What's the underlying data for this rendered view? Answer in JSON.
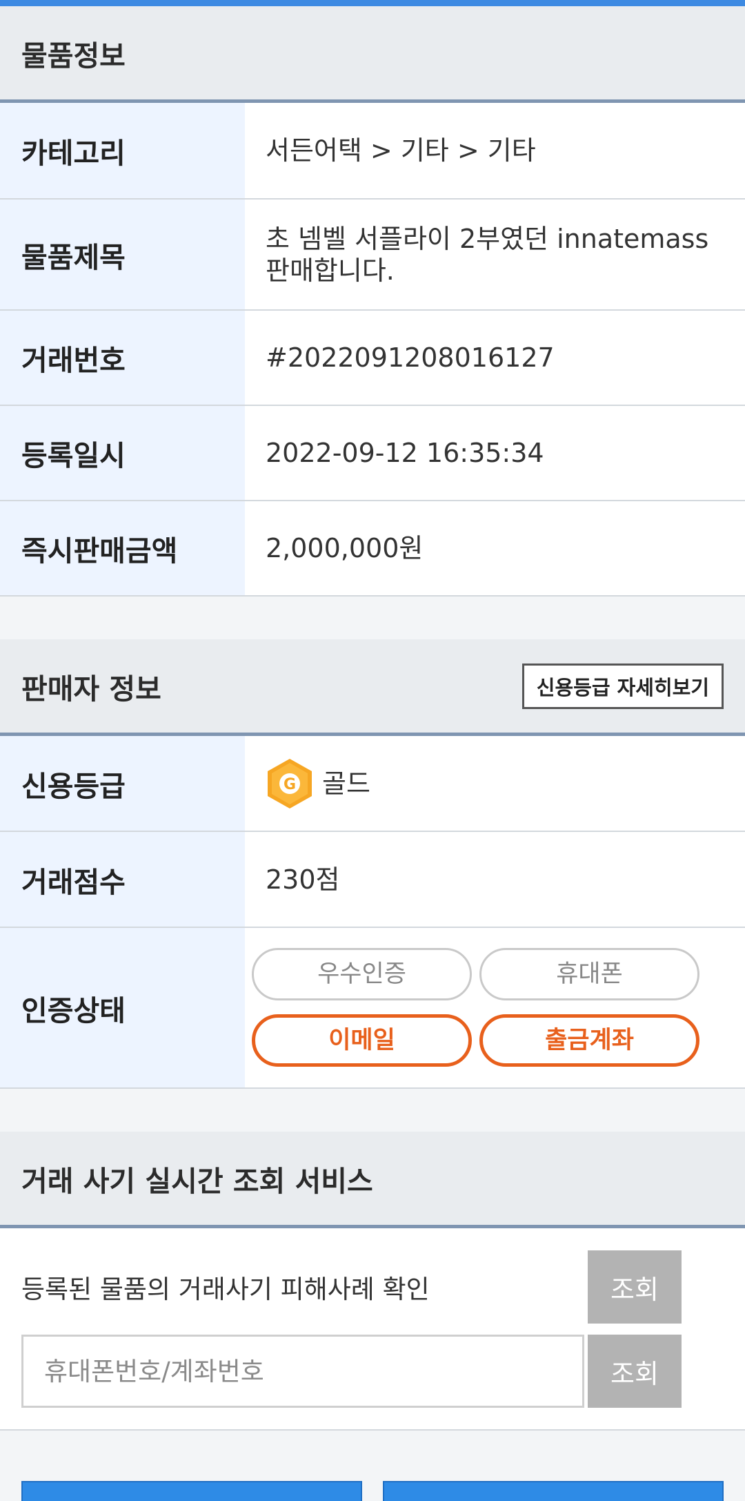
{
  "item_info": {
    "header": "물품정보",
    "rows": [
      {
        "label": "카테고리",
        "value": "서든어택 > 기타 > 기타"
      },
      {
        "label": "물품제목",
        "value": "초 넴벨 서플라이 2부였던 innatemass 판매합니다."
      },
      {
        "label": "거래번호",
        "value": "#2022091208016127"
      },
      {
        "label": "등록일시",
        "value": "2022-09-12 16:35:34"
      },
      {
        "label": "즉시판매금액",
        "value": "2,000,000원"
      }
    ]
  },
  "seller_info": {
    "header": "판매자 정보",
    "detail_button": "신용등급 자세히보기",
    "credit_label": "신용등급",
    "credit_icon_letter": "G",
    "credit_value": "골드",
    "score_label": "거래점수",
    "score_value": "230점",
    "auth_label": "인증상태",
    "auth_badges": [
      {
        "label": "우수인증",
        "active": false
      },
      {
        "label": "휴대폰",
        "active": false
      },
      {
        "label": "이메일",
        "active": true
      },
      {
        "label": "출금계좌",
        "active": true
      }
    ]
  },
  "fraud_check": {
    "header": "거래 사기 실시간 조회 서비스",
    "item_check_text": "등록된 물품의 거래사기 피해사례 확인",
    "query_label": "조회",
    "input_placeholder": "휴대폰번호/계좌번호",
    "input_value": ""
  },
  "colors": {
    "accent_orange": "#e8601c",
    "header_border": "#7f95b1",
    "top_accent": "#3d8ae2",
    "grade_gold": "#f6a623"
  }
}
